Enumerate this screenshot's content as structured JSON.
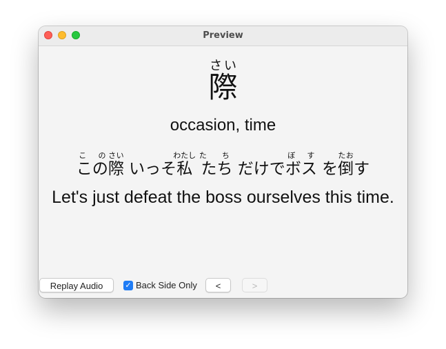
{
  "window": {
    "title": "Preview"
  },
  "card": {
    "kanji": "際",
    "kanji_reading": "さい",
    "meaning": "occasion, time",
    "sentence": [
      {
        "base": "この",
        "ruby": "こ の"
      },
      {
        "base": "際",
        "ruby": "さい"
      },
      {
        "base": " いっそ",
        "ruby": ""
      },
      {
        "base": "私",
        "ruby": "わたし"
      },
      {
        "base": " たち",
        "ruby": "た ち"
      },
      {
        "base": " だけで",
        "ruby": ""
      },
      {
        "base": "ボス",
        "ruby": "ぼ す"
      },
      {
        "base": " を",
        "ruby": ""
      },
      {
        "base": "倒",
        "ruby": "たお"
      },
      {
        "base": "す",
        "ruby": ""
      }
    ],
    "translation": "Let's just defeat the boss ourselves this time."
  },
  "toolbar": {
    "replay_label": "Replay Audio",
    "back_side_only_label": "Back Side Only",
    "back_side_only_checked": true,
    "prev_label": "<",
    "next_label": ">"
  },
  "colors": {
    "accent": "#1f7cf5",
    "close": "#fe5f57",
    "minimize": "#febc2e",
    "zoom": "#28c840"
  }
}
